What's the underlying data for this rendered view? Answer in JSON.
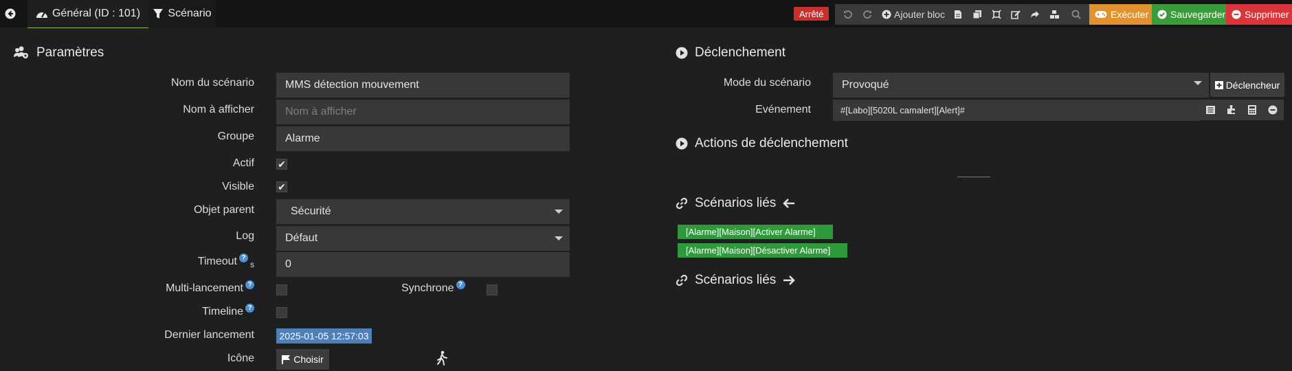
{
  "topbar": {
    "back_icon": "arrow-left-circle-icon",
    "tab_general": "Général (ID : 101)",
    "tab_scenario": "Scénario",
    "status": "Arrêté",
    "add_block": "Ajouter bloc",
    "run": "Exécuter",
    "save": "Sauvegarder",
    "delete": "Supprimer",
    "colors": {
      "run": "#e0922f",
      "save": "#3a9b3a",
      "delete": "#d9353a",
      "status": "#c9302c"
    }
  },
  "params": {
    "title": "Paramètres",
    "name_label": "Nom du scénario",
    "name_value": "MMS détection mouvement",
    "display_label": "Nom à afficher",
    "display_placeholder": "Nom à afficher",
    "group_label": "Groupe",
    "group_value": "Alarme",
    "active_label": "Actif",
    "visible_label": "Visible",
    "parent_label": "Objet parent",
    "parent_value": "Sécurité",
    "log_label": "Log",
    "log_value": "Défaut",
    "timeout_label": "Timeout",
    "timeout_unit": "s",
    "timeout_value": "0",
    "multi_label": "Multi-lancement",
    "sync_label": "Synchrone",
    "timeline_label": "Timeline",
    "last_run_label": "Dernier lancement",
    "last_run_value": "2025-01-05 12:57:03",
    "icon_label": "Icône",
    "choose_label": "Choisir"
  },
  "trigger": {
    "title": "Déclenchement",
    "mode_label": "Mode du scénario",
    "mode_value": "Provoqué",
    "add_trigger": "Déclencheur",
    "event_label": "Evénement",
    "event_value": "#[Labo][5020L camalert][Alert]#",
    "actions_title": "Actions de déclenchement"
  },
  "linked": {
    "title_in": "Scénarios liés",
    "title_out": "Scénarios liés",
    "items": [
      "[Alarme][Maison][Activer Alarme]",
      "[Alarme][Maison][Désactiver Alarme]"
    ]
  }
}
